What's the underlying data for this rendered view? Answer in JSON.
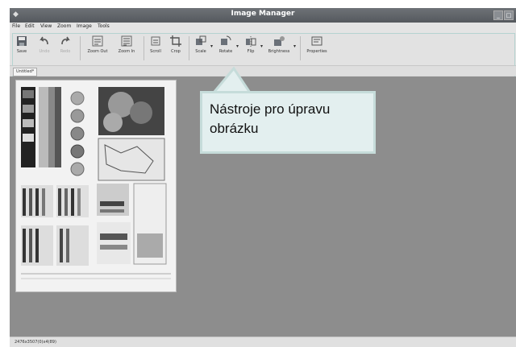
{
  "window": {
    "title": "Image Manager"
  },
  "menu": [
    {
      "label": "File",
      "name": "menu-file"
    },
    {
      "label": "Edit",
      "name": "menu-edit"
    },
    {
      "label": "View",
      "name": "menu-view"
    },
    {
      "label": "Zoom",
      "name": "menu-zoom"
    },
    {
      "label": "Image",
      "name": "menu-image"
    },
    {
      "label": "Tools",
      "name": "menu-tools"
    }
  ],
  "toolbar": {
    "save": "Save",
    "undo": "Undo",
    "redo": "Redo",
    "zoom_out": "Zoom Out",
    "zoom_in": "Zoom In",
    "scroll": "Scroll",
    "crop": "Crop",
    "scale": "Scale",
    "rotate": "Rotate",
    "flip": "Flip",
    "brightness": "Brightness",
    "properties": "Properties"
  },
  "tabs": {
    "active": "Untitled*"
  },
  "status": {
    "text": "2476x3507(0)x4(89)"
  },
  "callout": {
    "text": "Nástroje pro úpravu obrázku"
  },
  "colors": {
    "callout_bg": "#e3efef",
    "callout_border": "#c6dcda",
    "canvas": "#8d8d8d"
  }
}
